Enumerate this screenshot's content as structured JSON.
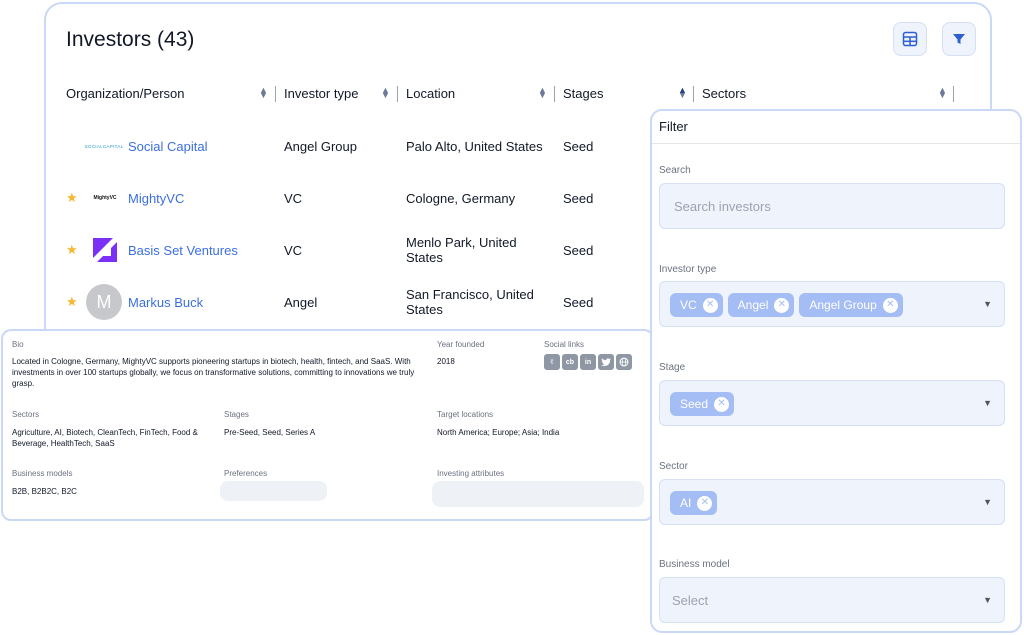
{
  "header": {
    "title": "Investors (43)",
    "table_icon": "table-icon",
    "filter_icon": "filter-icon"
  },
  "columns": [
    "Organization/Person",
    "Investor type",
    "Location",
    "Stages",
    "Sectors"
  ],
  "rows": [
    {
      "name": "Social Capital",
      "logo_text": "SOCIALCAPITAL",
      "type": "Angel Group",
      "location": "Palo Alto, United States",
      "stage": "Seed",
      "starred": false
    },
    {
      "name": "MightyVC",
      "logo_text": "MightyVC",
      "type": "VC",
      "location": "Cologne, Germany",
      "stage": "Seed",
      "starred": true
    },
    {
      "name": "Basis Set Ventures",
      "logo_text": "",
      "type": "VC",
      "location": "Menlo Park, United States",
      "stage": "Seed",
      "starred": true
    },
    {
      "name": "Markus Buck",
      "logo_text": "M",
      "type": "Angel",
      "location": "San Francisco, United States",
      "stage": "Seed",
      "starred": true
    }
  ],
  "detail": {
    "bio_label": "Bio",
    "bio": "Located in Cologne, Germany, MightyVC supports pioneering startups in biotech, health, fintech, and SaaS. With investments in over 100 startups globally, we focus on transformative solutions, committing to innovations we truly grasp.",
    "year_label": "Year founded",
    "year": "2018",
    "social_label": "Social links",
    "social_icons": [
      "angellist",
      "cb",
      "in",
      "twitter",
      "web"
    ],
    "sectors_label": "Sectors",
    "sectors": "Agriculture, AI, Biotech, CleanTech, FinTech, Food & Beverage, HealthTech, SaaS",
    "stages_label": "Stages",
    "stages": "Pre-Seed, Seed, Series A",
    "target_label": "Target locations",
    "target": "North America; Europe; Asia; India",
    "models_label": "Business models",
    "models": "B2B, B2B2C, B2C",
    "prefs_label": "Preferences",
    "attrs_label": "Investing attributes"
  },
  "filter": {
    "title": "Filter",
    "search_label": "Search",
    "search_placeholder": "Search investors",
    "type_label": "Investor type",
    "type_chips": [
      "VC",
      "Angel",
      "Angel Group"
    ],
    "stage_label": "Stage",
    "stage_chips": [
      "Seed"
    ],
    "sector_label": "Sector",
    "sector_chips": [
      "AI"
    ],
    "model_label": "Business model",
    "model_placeholder": "Select"
  },
  "colors": {
    "accent": "#3b6fe0",
    "border": "#c9d8f6",
    "chip": "#a5bdf5",
    "star": "#f5b82e"
  }
}
